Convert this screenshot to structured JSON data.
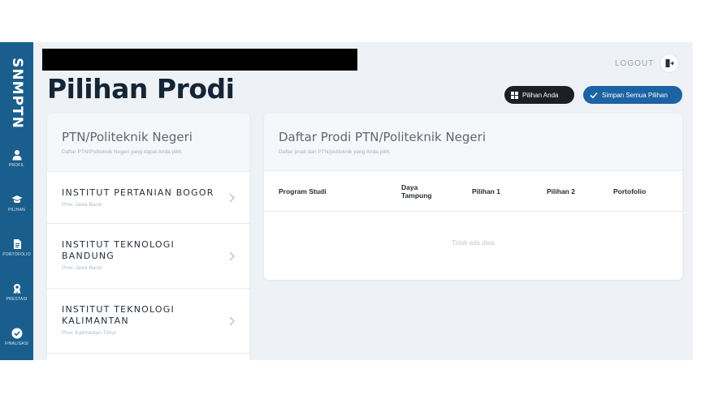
{
  "brand": "SNMPTN",
  "sidebar": {
    "items": [
      {
        "label": "PROFIL",
        "icon": "user-icon"
      },
      {
        "label": "PILIHAN",
        "icon": "graduation-cap-icon"
      },
      {
        "label": "PORTOFOLIO",
        "icon": "document-icon"
      },
      {
        "label": "PRESTASI",
        "icon": "award-icon"
      },
      {
        "label": "FINALISASI",
        "icon": "check-circle-icon"
      }
    ]
  },
  "header": {
    "title": "Pilihan Prodi",
    "logout_label": "LOGOUT",
    "pilihan_anda_label": "Pilihan Anda",
    "simpan_label": "Simpan Semua Pilihan"
  },
  "ptn_panel": {
    "title": "PTN/Politeknik Negeri",
    "subtitle": "Daftar PTN/Politeknik Negeri yang dapat Anda pilih.",
    "items": [
      {
        "name": "INSTITUT PERTANIAN BOGOR",
        "province": "Prov. Jawa Barat"
      },
      {
        "name": "INSTITUT TEKNOLOGI BANDUNG",
        "province": "Prov. Jawa Barat"
      },
      {
        "name": "INSTITUT TEKNOLOGI KALIMANTAN",
        "province": "Prov. Kalimantan Timur"
      }
    ]
  },
  "prodi_panel": {
    "title": "Daftar Prodi PTN/Politeknik Negeri",
    "subtitle": "Daftar prodi dari PTN/politeknik yang Anda pilih.",
    "columns": [
      "Program Studi",
      "Daya Tampung",
      "Pilihan 1",
      "Pilihan 2",
      "Portofolio"
    ],
    "empty_text": "Tidak ada data"
  },
  "colors": {
    "sidebar": "#1a5e8d",
    "primary_button": "#1b63a3",
    "dark_button": "#1e1f24",
    "background": "#eef1f5"
  }
}
